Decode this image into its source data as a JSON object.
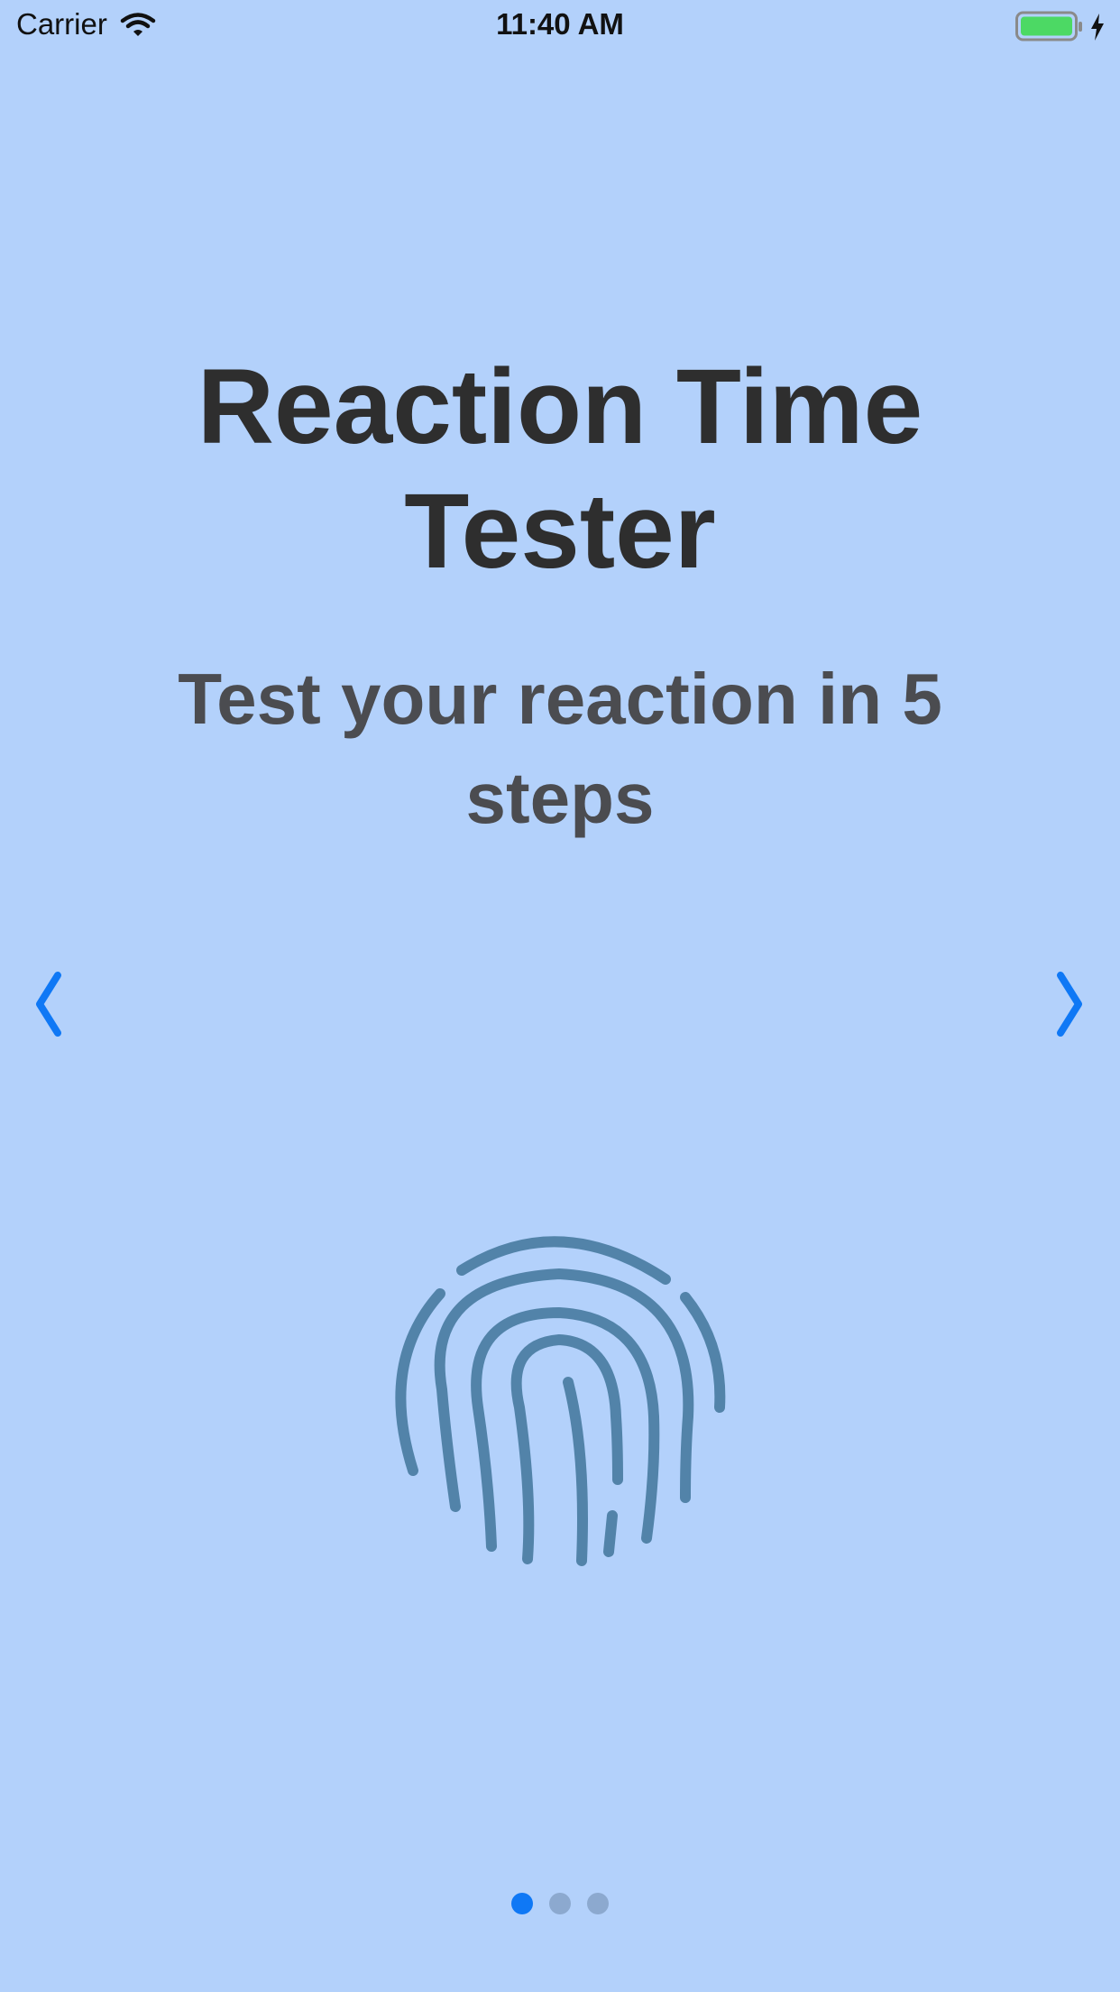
{
  "status_bar": {
    "carrier": "Carrier",
    "time": "11:40 AM",
    "icons": [
      "wifi-icon",
      "battery-icon",
      "charging-icon"
    ]
  },
  "main": {
    "title": "Reaction Time Tester",
    "subtitle": "Test your reaction in 5 steps",
    "center_icon": "fingerprint-icon"
  },
  "navigation": {
    "prev_icon": "chevron-left-icon",
    "next_icon": "chevron-right-icon"
  },
  "pager": {
    "page_count": 3,
    "current_page": 1
  },
  "colors": {
    "background": "#b3d1fb",
    "title_text": "#2e2e2e",
    "subtitle_text": "#4b4c50",
    "accent": "#0f78f5",
    "fingerprint": "#5283a9",
    "inactive_dot": "#8ca9cf",
    "battery_fill": "#4cd964"
  }
}
